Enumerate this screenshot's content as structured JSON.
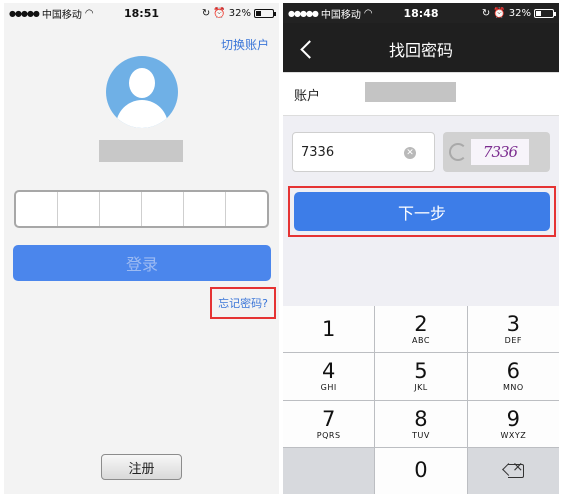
{
  "left_screen": {
    "status_bar": {
      "signal": "●●●●●",
      "carrier": "中国移动",
      "time": "18:51",
      "battery": "32%",
      "battery_level": 0.32
    },
    "switch_account_link": "切换账户",
    "login_button": "登录",
    "forgot_password_link": "忘记密码?",
    "register_button": "注册",
    "password_boxes": 6
  },
  "right_screen": {
    "status_bar": {
      "signal": "●●●●●",
      "carrier": "中国移动",
      "time": "18:48",
      "battery": "32%",
      "battery_level": 0.32
    },
    "nav_title": "找回密码",
    "account_label": "账户",
    "code_input_value": "7336",
    "captcha_text": "7336",
    "next_button": "下一步",
    "keypad": [
      {
        "digit": "1",
        "letters": ""
      },
      {
        "digit": "2",
        "letters": "ABC"
      },
      {
        "digit": "3",
        "letters": "DEF"
      },
      {
        "digit": "4",
        "letters": "GHI"
      },
      {
        "digit": "5",
        "letters": "JKL"
      },
      {
        "digit": "6",
        "letters": "MNO"
      },
      {
        "digit": "7",
        "letters": "PQRS"
      },
      {
        "digit": "8",
        "letters": "TUV"
      },
      {
        "digit": "9",
        "letters": "WXYZ"
      },
      {
        "digit": "0",
        "letters": ""
      }
    ]
  },
  "colors": {
    "accent_blue": "#3d7de8",
    "highlight_red": "#e53333",
    "nav_dark": "#1f1f1f"
  }
}
